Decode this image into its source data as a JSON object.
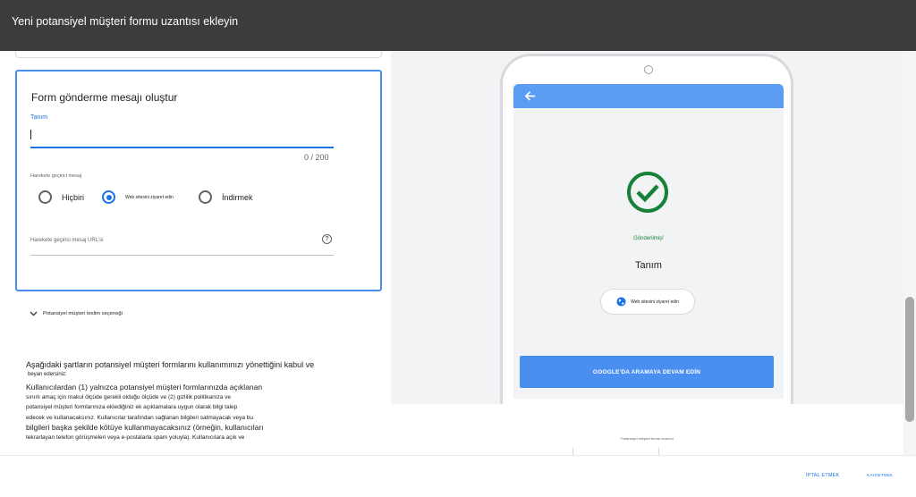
{
  "dialog": {
    "title": "Yeni potansiyel müşteri formu uzantısı ekleyin"
  },
  "form_message": {
    "title": "Form gönderme mesajı oluştur",
    "description_label": "Tanım",
    "description_value": "",
    "counter": "0 / 200",
    "cta_group_label": "Harekete geçirici mesaj",
    "options": [
      {
        "label": "Hiçbiri",
        "selected": false
      },
      {
        "label": "Web sitesini ziyaret edin",
        "selected": true
      },
      {
        "label": "İndirmek",
        "selected": false
      }
    ],
    "url_label": "Harekete geçirici mesaj URL'si",
    "help_icon": "?"
  },
  "delivery": {
    "label": "Potansiyel müşteri teslim seçeneği"
  },
  "terms": {
    "heading": "Aşağıdaki şartların potansiyel müşteri formlarını kullanımınızı yönettiğini kabul ve",
    "subheading": "beyan edersiniz:",
    "lines": [
      "Kullanıcılardan (1) yalnızca potansiyel müşteri formlarınızda açıklanan",
      "sınırlı amaç için makul ölçüde gerekli olduğu ölçüde ve (2) gizlilik politikanıza ve",
      "potansiyel müşteri formlarınıza eklediğiniz ek açıklamalara uygun olarak bilgi talep",
      "edecek ve kullanacaksınız. Kullanıcılar tarafından sağlanan bilgileri satmayacak veya bu",
      "bilgileri başka şekilde kötüye kullanmayacaksınız (örneğin, kullanıcıları",
      "tekrarlayan telefon görüşmeleri veya e-postalarla spam yoluyla). Kullanıcılara açık ve"
    ]
  },
  "preview": {
    "submitted": "Gönderilmiş!",
    "description": "Tanım",
    "visit_button": "Web sitesini ziyaret edin",
    "google_button": "GOOGLE'DA ARAMAYA DEVAM EDİN",
    "status_label": "Potansiyel müşteri formu durumu",
    "appbar_color": "#5b9cf4",
    "check_color": "#188038",
    "icons": [
      "back-arrow",
      "check-circle",
      "globe"
    ]
  },
  "footer": {
    "cancel": "İPTAL ETMEK",
    "save": "KAYDETMEK"
  }
}
